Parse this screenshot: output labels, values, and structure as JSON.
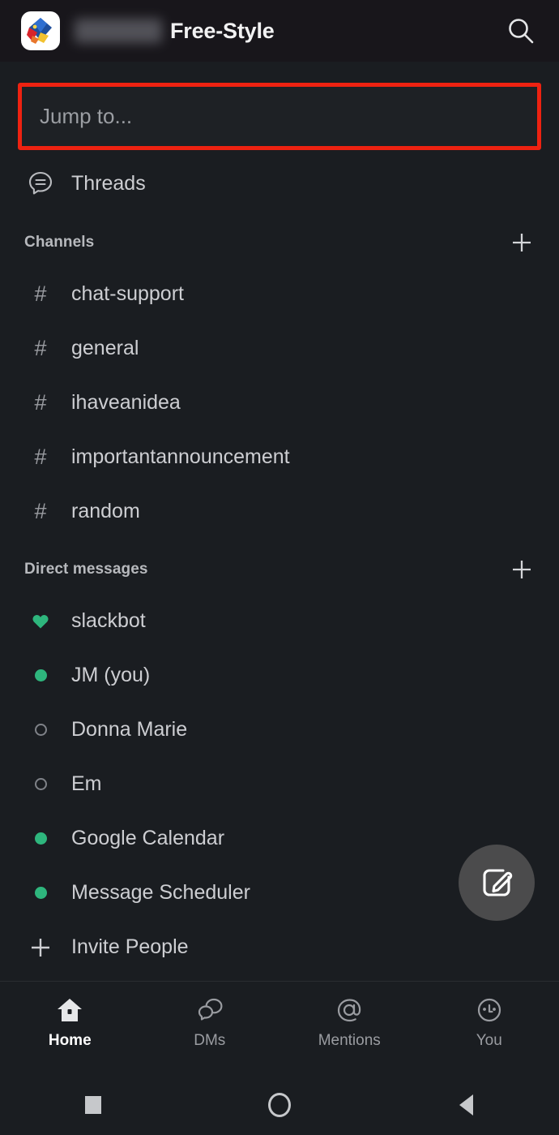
{
  "header": {
    "workspace_icon": "workspace-logo",
    "workspace_name_redacted": "",
    "workspace_name": "Free-Style",
    "search_icon": "search-icon"
  },
  "search": {
    "placeholder": "Jump to...",
    "highlight_color": "#ee2211"
  },
  "threads": {
    "label": "Threads",
    "icon": "threads-bubble-icon"
  },
  "channels_section": {
    "title": "Channels",
    "add_icon": "plus-icon",
    "items": [
      {
        "prefix": "#",
        "label": "chat-support"
      },
      {
        "prefix": "#",
        "label": "general"
      },
      {
        "prefix": "#",
        "label": "ihaveanidea"
      },
      {
        "prefix": "#",
        "label": "importantannouncement"
      },
      {
        "prefix": "#",
        "label": "random"
      }
    ]
  },
  "dm_section": {
    "title": "Direct messages",
    "add_icon": "plus-icon",
    "items": [
      {
        "label": "slackbot",
        "presence": "heart",
        "icon": "heart-icon"
      },
      {
        "label": "JM (you)",
        "presence": "online",
        "icon": "presence-dot-online"
      },
      {
        "label": "Donna Marie",
        "presence": "offline",
        "icon": "presence-dot-offline"
      },
      {
        "label": "Em",
        "presence": "offline",
        "icon": "presence-dot-offline"
      },
      {
        "label": "Google Calendar",
        "presence": "online",
        "icon": "presence-dot-online"
      },
      {
        "label": "Message Scheduler",
        "presence": "online",
        "icon": "presence-dot-online"
      }
    ],
    "invite": {
      "label": "Invite People",
      "icon": "plus-icon"
    }
  },
  "compose_fab": {
    "icon": "compose-pencil-icon"
  },
  "bottom_nav": {
    "items": [
      {
        "label": "Home",
        "icon": "home-icon",
        "active": true
      },
      {
        "label": "DMs",
        "icon": "dms-bubbles-icon",
        "active": false
      },
      {
        "label": "Mentions",
        "icon": "at-sign-icon",
        "active": false
      },
      {
        "label": "You",
        "icon": "you-avatar-icon",
        "active": false
      }
    ]
  },
  "android_nav": {
    "recents_icon": "square-recents-icon",
    "home_icon": "circle-home-icon",
    "back_icon": "triangle-back-icon"
  },
  "colors": {
    "background": "#1a1d21",
    "header_background": "#18161b",
    "accent_green": "#2eb67d",
    "highlight_red": "#ee2211",
    "text_primary": "#cdced2"
  }
}
